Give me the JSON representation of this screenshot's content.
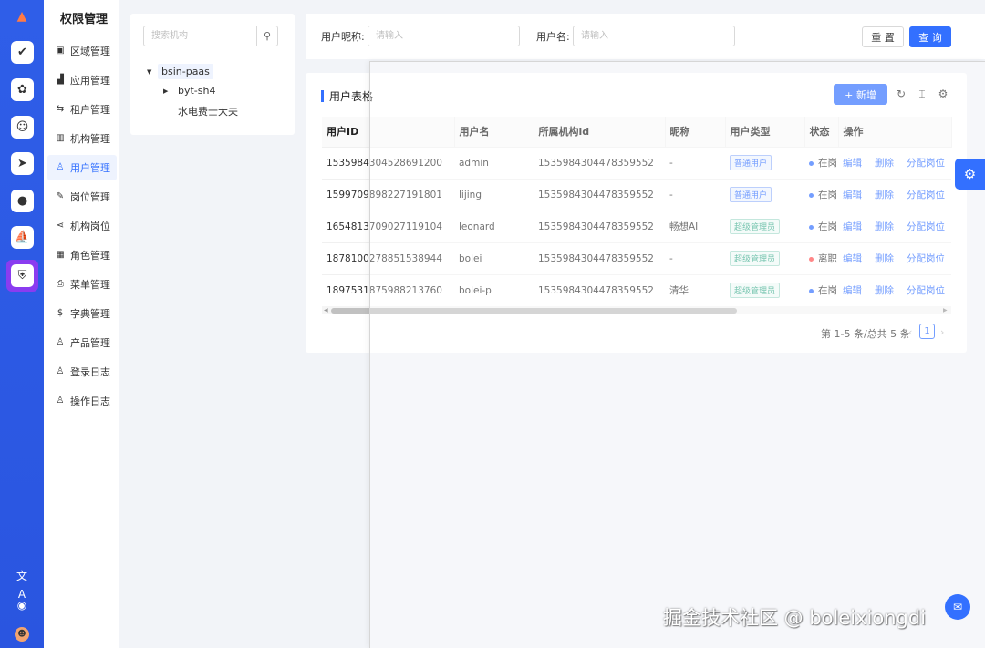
{
  "rail": {
    "logo": "▲",
    "apps": [
      {
        "name": "app-check-icon",
        "glyph": "✔"
      },
      {
        "name": "app-brain-icon",
        "glyph": "✿"
      },
      {
        "name": "app-people-icon",
        "glyph": "☺"
      },
      {
        "name": "app-bird-icon",
        "glyph": "➤"
      },
      {
        "name": "app-globe-icon",
        "glyph": "●"
      },
      {
        "name": "app-ship-icon",
        "glyph": "⛵"
      },
      {
        "name": "app-shield-icon",
        "glyph": "⛨"
      }
    ],
    "translate_icon": "文A",
    "github_icon": "◉",
    "avatar": "☻"
  },
  "menu": {
    "title": "权限管理",
    "items": [
      {
        "label": "区域管理",
        "icon": "▣"
      },
      {
        "label": "应用管理",
        "icon": "▟"
      },
      {
        "label": "租户管理",
        "icon": "⇆"
      },
      {
        "label": "机构管理",
        "icon": "▥"
      },
      {
        "label": "用户管理",
        "icon": "♙",
        "active": true
      },
      {
        "label": "岗位管理",
        "icon": "✎"
      },
      {
        "label": "机构岗位",
        "icon": "⋖"
      },
      {
        "label": "角色管理",
        "icon": "▦"
      },
      {
        "label": "菜单管理",
        "icon": "⎙"
      },
      {
        "label": "字典管理",
        "icon": "$"
      },
      {
        "label": "产品管理",
        "icon": "♙"
      },
      {
        "label": "登录日志",
        "icon": "♙"
      },
      {
        "label": "操作日志",
        "icon": "♙"
      }
    ]
  },
  "tree": {
    "search_placeholder": "搜索机构",
    "search_icon": "⚲",
    "nodes": [
      {
        "label": "bsin-paas",
        "caret": "▼",
        "selected": true
      },
      {
        "label": "byt-sh4",
        "caret": "▶"
      },
      {
        "label": "水电费士大夫",
        "caret": ""
      }
    ]
  },
  "filter": {
    "nickname_label": "用户昵称:",
    "nickname_placeholder": "请输入",
    "username_label": "用户名:",
    "username_placeholder": "请输入",
    "reset_label": "重 置",
    "query_label": "查 询"
  },
  "table": {
    "title": "用户表格",
    "add_label": "+ 新增",
    "reload_icon": "↻",
    "density_icon": "⌶",
    "settings_icon": "⚙",
    "columns": [
      "用户ID",
      "用户名",
      "所属机构id",
      "昵称",
      "用户类型",
      "状态",
      "操作"
    ],
    "rows": [
      {
        "id": "1535984304528691200",
        "username": "admin",
        "org": "1535984304478359552",
        "nick": "-",
        "type": "普通用户",
        "type_kind": "normal",
        "status": "在岗",
        "status_color": "#3370ff"
      },
      {
        "id": "1599709898227191801",
        "username": "lijing",
        "org": "1535984304478359552",
        "nick": "-",
        "type": "普通用户",
        "type_kind": "normal",
        "status": "在岗",
        "status_color": "#3370ff"
      },
      {
        "id": "1654813709027119104",
        "username": "leonard",
        "org": "1535984304478359552",
        "nick": "畅想AI",
        "type": "超级管理员",
        "type_kind": "super",
        "status": "在岗",
        "status_color": "#3370ff"
      },
      {
        "id": "1878100278851538944",
        "username": "bolei",
        "org": "1535984304478359552",
        "nick": "-",
        "type": "超级管理员",
        "type_kind": "super",
        "status": "离职",
        "status_color": "#ff4d4f"
      },
      {
        "id": "1897531875988213760",
        "username": "bolei-p",
        "org": "1535984304478359552",
        "nick": "清华",
        "type": "超级管理员",
        "type_kind": "super",
        "status": "在岗",
        "status_color": "#3370ff"
      }
    ],
    "actions": [
      "编辑",
      "删除",
      "分配岗位"
    ],
    "pagination": {
      "total": "第 1-5 条/总共 5 条",
      "current": "1",
      "prev": "‹",
      "next": "›"
    }
  },
  "settings_fab_icon": "⚙",
  "float_icon": "✉",
  "watermark": "掘金技术社区 @ boleixiongdi"
}
